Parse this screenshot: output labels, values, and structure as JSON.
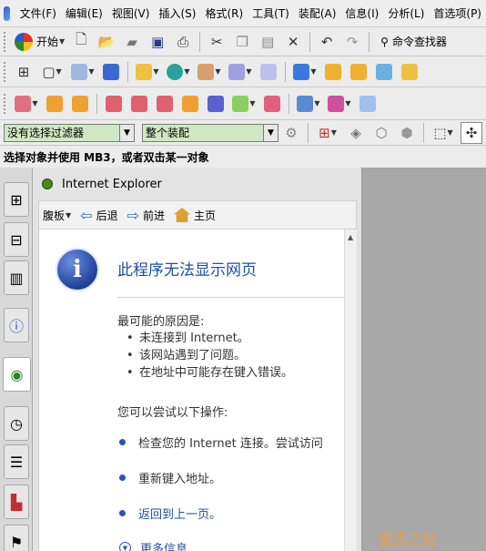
{
  "menu": [
    "文件(F)",
    "编辑(E)",
    "视图(V)",
    "插入(S)",
    "格式(R)",
    "工具(T)",
    "装配(A)",
    "信息(I)",
    "分析(L)",
    "首选项(P)"
  ],
  "toolbar1": {
    "start_label": "开始",
    "command_finder_label": "命令查找器",
    "icons": [
      "start-icon",
      "new-icon",
      "open-icon",
      "open-part-icon",
      "save-icon",
      "print-icon",
      "cut-icon",
      "copy-icon",
      "paste-icon",
      "delete-icon",
      "undo-icon",
      "redo-icon"
    ]
  },
  "filters": {
    "selection_filter": "没有选择过滤器",
    "scope": "整个装配"
  },
  "status": "选择对象并使用 MB3，或者双击某一对象",
  "ie": {
    "title": "Internet Explorer",
    "nav": {
      "page_label": "腹板",
      "back_label": "后退",
      "forward_label": "前进",
      "home_label": "主页"
    },
    "error_title": "此程序无法显示网页",
    "reason_heading": "最可能的原因是:",
    "reasons": [
      "未连接到 Internet。",
      "该网站遇到了问题。",
      "在地址中可能存在键入错误。"
    ],
    "try_heading": "您可以尝试以下操作:",
    "actions": [
      "检查您的 Internet 连接。尝试访问",
      "重新键入地址。",
      "返回到上一页。",
      "更多信息"
    ]
  },
  "watermark": "盘古之始",
  "colors": {
    "select_bg": "#cfe8c2",
    "link_blue": "#1f4fa0",
    "info_blue": "#1f3f9a",
    "watermark": "#e8a050"
  }
}
